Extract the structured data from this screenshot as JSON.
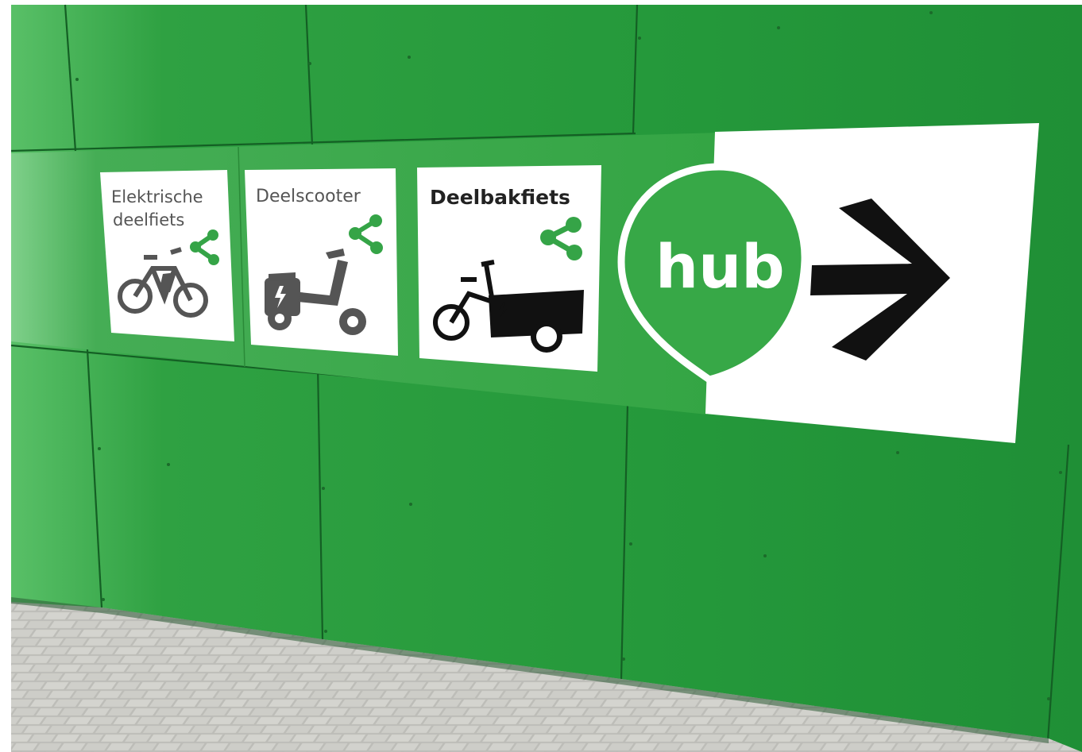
{
  "sign": {
    "tiles": [
      {
        "line1": "Elektrische",
        "line2": "deelfiets",
        "icon": "electric-bike-icon"
      },
      {
        "line1": "Deelscooter",
        "line2": "",
        "icon": "scooter-icon"
      },
      {
        "line1": "Deelbakfiets",
        "line2": "",
        "icon": "cargo-bike-icon"
      }
    ],
    "hub_label": "hub",
    "direction": "right",
    "share_icon": "share-icon"
  },
  "colors": {
    "wall_green": "#27a03f",
    "sign_green": "#37a847",
    "icon_green": "#35a447",
    "tile_white": "#ffffff",
    "glyph_dark": "#1a1a1a",
    "glyph_grey": "#555555",
    "pavement": "#b9b9b4"
  }
}
